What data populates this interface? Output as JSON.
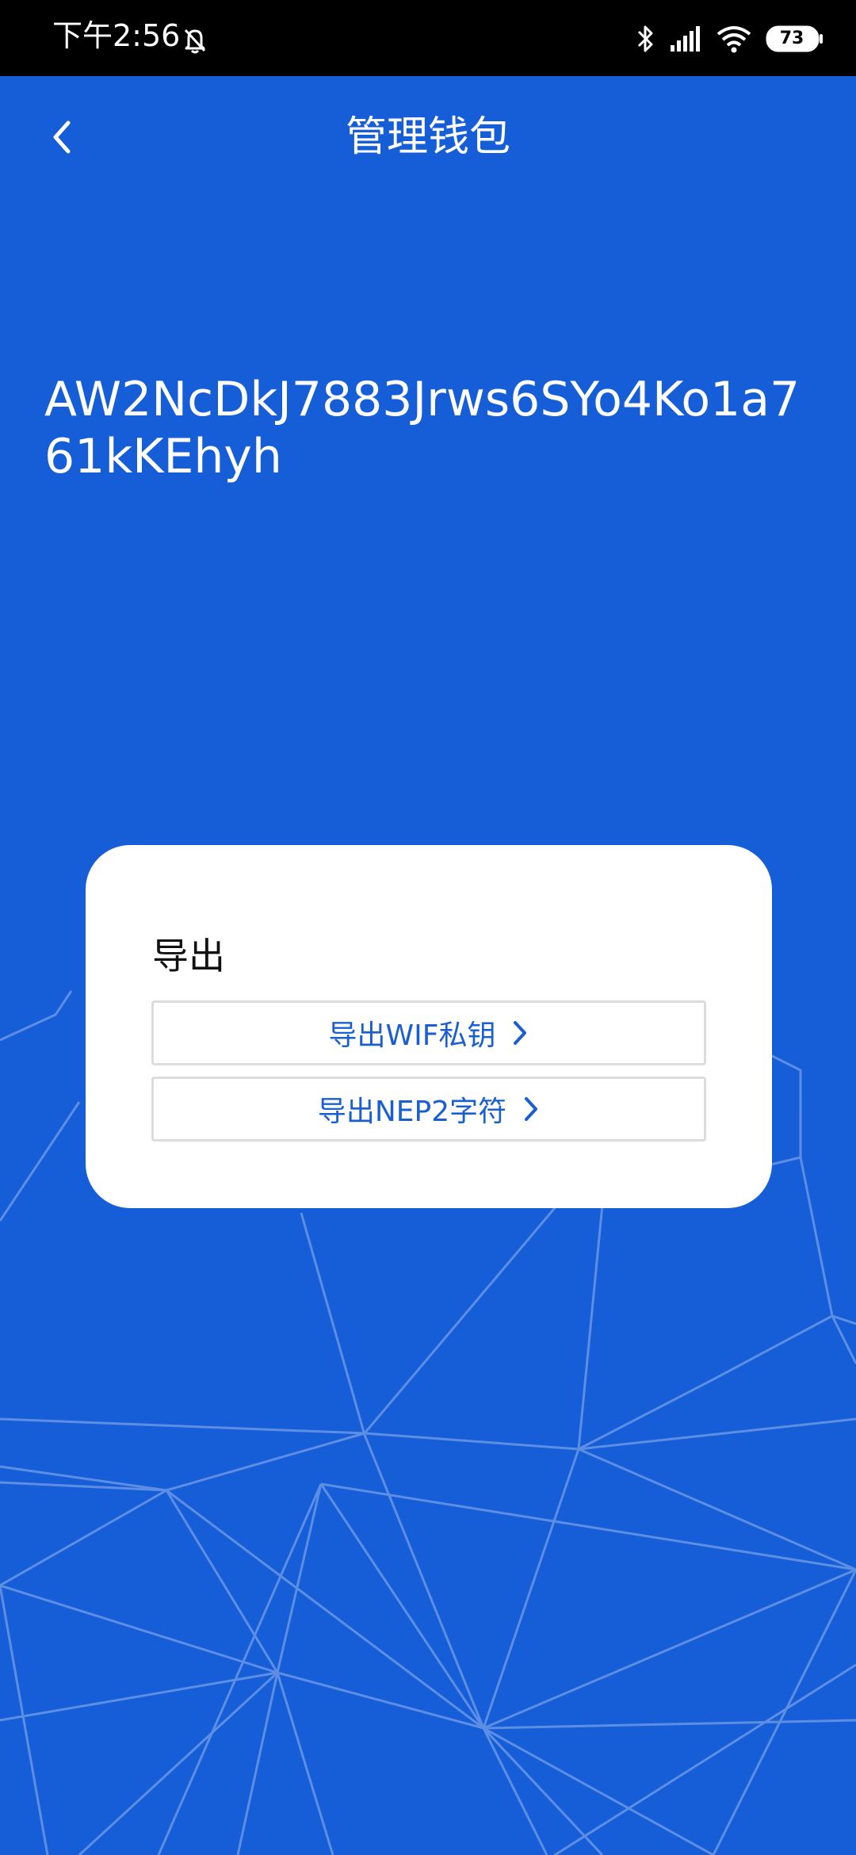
{
  "status_bar": {
    "time": "下午2:56",
    "battery": "73",
    "icons": [
      "bell-off-icon",
      "bluetooth-icon",
      "signal-icon",
      "wifi-icon",
      "battery-icon"
    ]
  },
  "header": {
    "title": "管理钱包",
    "back_icon": "chevron-left-icon"
  },
  "wallet": {
    "address": "AW2NcDkJ7883Jrws6SYo4Ko1a761kKEhyh"
  },
  "export_card": {
    "heading": "导出",
    "wif_button": "导出WIF私钥",
    "nep2_button": "导出NEP2字符",
    "chevron_icon": "chevron-right-icon"
  },
  "colors": {
    "background": "#155ed8",
    "accent": "#1a5fd2",
    "card": "#ffffff",
    "status_bar": "#000000"
  }
}
